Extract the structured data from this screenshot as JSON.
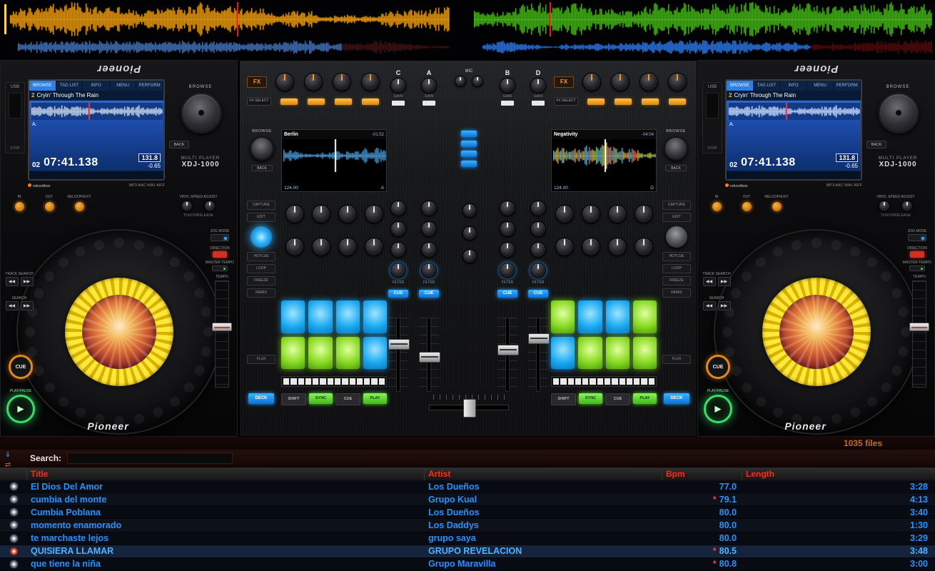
{
  "colors": {
    "accent_blue": "#2492ff",
    "accent_green": "#5ad62a",
    "accent_orange": "#e08818",
    "header_red": "#ff2a1a"
  },
  "deck": {
    "brand": "Pioneer",
    "labels": {
      "usb": "USB",
      "stop": "STOP",
      "browse": "BROWSE",
      "back": "BACK",
      "multi_player": "MULTI PLAYER",
      "model": "XDJ-1000",
      "rekordbox": "rekordbox",
      "formats": "MP3 AAC WAV AIFF",
      "loop_in": "IN",
      "loop_out": "OUT",
      "reloop": "RELOOP/EXIT",
      "vinyl": "VINYL SPEED ADJUST",
      "touch": "TOUCH/RELEASE",
      "track_search": "TRACK SEARCH",
      "search": "SEARCH",
      "cue": "CUE",
      "play": "PLAY/PAUSE",
      "jog_mode": "JOG MODE",
      "direction": "DIRECTION",
      "tempo": "TEMPO",
      "master_tempo": "MASTER TEMPO"
    },
    "screen": {
      "tabs": [
        "BROWSE",
        "TAG LIST",
        "INFO",
        "MENU",
        "PERFORM"
      ],
      "track_number": "2",
      "track_title": "Cryin' Through The Rain",
      "deck_letter": "A.",
      "playlist_pos": "02",
      "time": "07:41.138",
      "bpm": "131.8",
      "tempo": "-0.65"
    }
  },
  "mixer": {
    "fx": "FX",
    "fx_select": "FX SELECT",
    "gain": "GAIN",
    "channels": [
      "C",
      "A",
      "B",
      "D"
    ],
    "mic": "MIC",
    "browse": "BROWSE",
    "back": "BACK",
    "filter": "FILTER",
    "cue": "CUE",
    "capture": "CAPTURE",
    "edit": "EDIT",
    "pad_modes": [
      "HOTCUE",
      "LOOP",
      "FREEZE",
      "REMIX"
    ],
    "flux": "FLUX",
    "deck_button": "DECK",
    "shift": "SHIFT",
    "sync": "SYNC",
    "play": "PLAY",
    "left_screen": {
      "title": "Berlin",
      "time": "-01:52",
      "bpm": "124.00",
      "deck": "A"
    },
    "right_screen": {
      "title": "Negativity",
      "time": "-04:04",
      "bpm": "124.00",
      "deck": "D"
    },
    "left_pads": [
      "blue",
      "blue",
      "blue",
      "blue",
      "green",
      "green",
      "green",
      "blue"
    ],
    "right_pads": [
      "green",
      "blue",
      "blue",
      "green",
      "blue",
      "green",
      "green",
      "green"
    ]
  },
  "library": {
    "search_label": "Search:",
    "files_count": "1035 files",
    "columns": [
      "Title",
      "Artist",
      "Bpm",
      "Length"
    ],
    "tracks": [
      {
        "title": "El Dios Del Amor",
        "artist": "Los Dueños",
        "bpm": "77.0",
        "length": "3:28",
        "flag": false,
        "selected": false
      },
      {
        "title": "cumbia del monte",
        "artist": "Grupo Kual",
        "bpm": "79.1",
        "length": "4:13",
        "flag": true,
        "selected": false
      },
      {
        "title": "Cumbia Poblana",
        "artist": "Los Dueños",
        "bpm": "80.0",
        "length": "3:40",
        "flag": false,
        "selected": false
      },
      {
        "title": "momento enamorado",
        "artist": "Los Daddys",
        "bpm": "80.0",
        "length": "1:30",
        "flag": false,
        "selected": false
      },
      {
        "title": "te marchaste lejos",
        "artist": "grupo saya",
        "bpm": "80.0",
        "length": "3:29",
        "flag": false,
        "selected": false
      },
      {
        "title": "QUISIERA LLAMAR",
        "artist": "GRUPO REVELACION",
        "bpm": "80.5",
        "length": "3:48",
        "flag": true,
        "selected": true
      },
      {
        "title": "que tiene la niña",
        "artist": "Grupo Maravilla",
        "bpm": "80.8",
        "length": "3:00",
        "flag": true,
        "selected": false
      }
    ]
  }
}
